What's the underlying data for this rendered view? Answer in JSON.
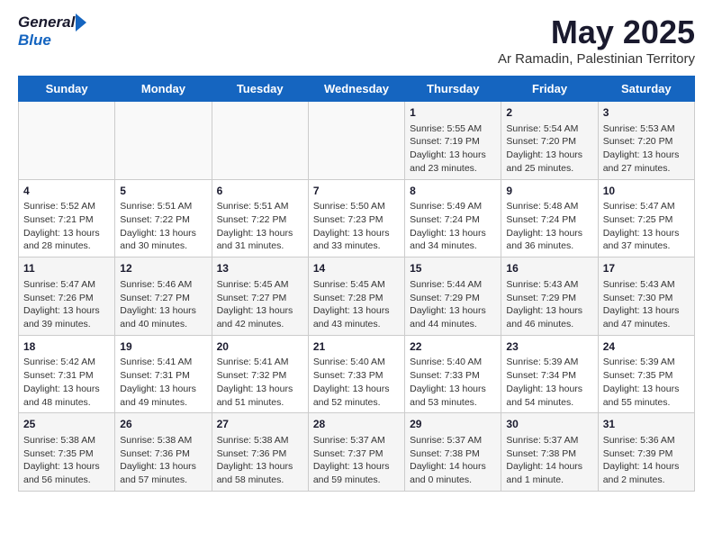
{
  "header": {
    "logo_general": "General",
    "logo_blue": "Blue",
    "title": "May 2025",
    "subtitle": "Ar Ramadin, Palestinian Territory"
  },
  "days_of_week": [
    "Sunday",
    "Monday",
    "Tuesday",
    "Wednesday",
    "Thursday",
    "Friday",
    "Saturday"
  ],
  "weeks": [
    {
      "days": [
        {
          "num": "",
          "sunrise": "",
          "sunset": "",
          "daylight": ""
        },
        {
          "num": "",
          "sunrise": "",
          "sunset": "",
          "daylight": ""
        },
        {
          "num": "",
          "sunrise": "",
          "sunset": "",
          "daylight": ""
        },
        {
          "num": "",
          "sunrise": "",
          "sunset": "",
          "daylight": ""
        },
        {
          "num": "1",
          "sunrise": "Sunrise: 5:55 AM",
          "sunset": "Sunset: 7:19 PM",
          "daylight": "Daylight: 13 hours and 23 minutes."
        },
        {
          "num": "2",
          "sunrise": "Sunrise: 5:54 AM",
          "sunset": "Sunset: 7:20 PM",
          "daylight": "Daylight: 13 hours and 25 minutes."
        },
        {
          "num": "3",
          "sunrise": "Sunrise: 5:53 AM",
          "sunset": "Sunset: 7:20 PM",
          "daylight": "Daylight: 13 hours and 27 minutes."
        }
      ]
    },
    {
      "days": [
        {
          "num": "4",
          "sunrise": "Sunrise: 5:52 AM",
          "sunset": "Sunset: 7:21 PM",
          "daylight": "Daylight: 13 hours and 28 minutes."
        },
        {
          "num": "5",
          "sunrise": "Sunrise: 5:51 AM",
          "sunset": "Sunset: 7:22 PM",
          "daylight": "Daylight: 13 hours and 30 minutes."
        },
        {
          "num": "6",
          "sunrise": "Sunrise: 5:51 AM",
          "sunset": "Sunset: 7:22 PM",
          "daylight": "Daylight: 13 hours and 31 minutes."
        },
        {
          "num": "7",
          "sunrise": "Sunrise: 5:50 AM",
          "sunset": "Sunset: 7:23 PM",
          "daylight": "Daylight: 13 hours and 33 minutes."
        },
        {
          "num": "8",
          "sunrise": "Sunrise: 5:49 AM",
          "sunset": "Sunset: 7:24 PM",
          "daylight": "Daylight: 13 hours and 34 minutes."
        },
        {
          "num": "9",
          "sunrise": "Sunrise: 5:48 AM",
          "sunset": "Sunset: 7:24 PM",
          "daylight": "Daylight: 13 hours and 36 minutes."
        },
        {
          "num": "10",
          "sunrise": "Sunrise: 5:47 AM",
          "sunset": "Sunset: 7:25 PM",
          "daylight": "Daylight: 13 hours and 37 minutes."
        }
      ]
    },
    {
      "days": [
        {
          "num": "11",
          "sunrise": "Sunrise: 5:47 AM",
          "sunset": "Sunset: 7:26 PM",
          "daylight": "Daylight: 13 hours and 39 minutes."
        },
        {
          "num": "12",
          "sunrise": "Sunrise: 5:46 AM",
          "sunset": "Sunset: 7:27 PM",
          "daylight": "Daylight: 13 hours and 40 minutes."
        },
        {
          "num": "13",
          "sunrise": "Sunrise: 5:45 AM",
          "sunset": "Sunset: 7:27 PM",
          "daylight": "Daylight: 13 hours and 42 minutes."
        },
        {
          "num": "14",
          "sunrise": "Sunrise: 5:45 AM",
          "sunset": "Sunset: 7:28 PM",
          "daylight": "Daylight: 13 hours and 43 minutes."
        },
        {
          "num": "15",
          "sunrise": "Sunrise: 5:44 AM",
          "sunset": "Sunset: 7:29 PM",
          "daylight": "Daylight: 13 hours and 44 minutes."
        },
        {
          "num": "16",
          "sunrise": "Sunrise: 5:43 AM",
          "sunset": "Sunset: 7:29 PM",
          "daylight": "Daylight: 13 hours and 46 minutes."
        },
        {
          "num": "17",
          "sunrise": "Sunrise: 5:43 AM",
          "sunset": "Sunset: 7:30 PM",
          "daylight": "Daylight: 13 hours and 47 minutes."
        }
      ]
    },
    {
      "days": [
        {
          "num": "18",
          "sunrise": "Sunrise: 5:42 AM",
          "sunset": "Sunset: 7:31 PM",
          "daylight": "Daylight: 13 hours and 48 minutes."
        },
        {
          "num": "19",
          "sunrise": "Sunrise: 5:41 AM",
          "sunset": "Sunset: 7:31 PM",
          "daylight": "Daylight: 13 hours and 49 minutes."
        },
        {
          "num": "20",
          "sunrise": "Sunrise: 5:41 AM",
          "sunset": "Sunset: 7:32 PM",
          "daylight": "Daylight: 13 hours and 51 minutes."
        },
        {
          "num": "21",
          "sunrise": "Sunrise: 5:40 AM",
          "sunset": "Sunset: 7:33 PM",
          "daylight": "Daylight: 13 hours and 52 minutes."
        },
        {
          "num": "22",
          "sunrise": "Sunrise: 5:40 AM",
          "sunset": "Sunset: 7:33 PM",
          "daylight": "Daylight: 13 hours and 53 minutes."
        },
        {
          "num": "23",
          "sunrise": "Sunrise: 5:39 AM",
          "sunset": "Sunset: 7:34 PM",
          "daylight": "Daylight: 13 hours and 54 minutes."
        },
        {
          "num": "24",
          "sunrise": "Sunrise: 5:39 AM",
          "sunset": "Sunset: 7:35 PM",
          "daylight": "Daylight: 13 hours and 55 minutes."
        }
      ]
    },
    {
      "days": [
        {
          "num": "25",
          "sunrise": "Sunrise: 5:38 AM",
          "sunset": "Sunset: 7:35 PM",
          "daylight": "Daylight: 13 hours and 56 minutes."
        },
        {
          "num": "26",
          "sunrise": "Sunrise: 5:38 AM",
          "sunset": "Sunset: 7:36 PM",
          "daylight": "Daylight: 13 hours and 57 minutes."
        },
        {
          "num": "27",
          "sunrise": "Sunrise: 5:38 AM",
          "sunset": "Sunset: 7:36 PM",
          "daylight": "Daylight: 13 hours and 58 minutes."
        },
        {
          "num": "28",
          "sunrise": "Sunrise: 5:37 AM",
          "sunset": "Sunset: 7:37 PM",
          "daylight": "Daylight: 13 hours and 59 minutes."
        },
        {
          "num": "29",
          "sunrise": "Sunrise: 5:37 AM",
          "sunset": "Sunset: 7:38 PM",
          "daylight": "Daylight: 14 hours and 0 minutes."
        },
        {
          "num": "30",
          "sunrise": "Sunrise: 5:37 AM",
          "sunset": "Sunset: 7:38 PM",
          "daylight": "Daylight: 14 hours and 1 minute."
        },
        {
          "num": "31",
          "sunrise": "Sunrise: 5:36 AM",
          "sunset": "Sunset: 7:39 PM",
          "daylight": "Daylight: 14 hours and 2 minutes."
        }
      ]
    }
  ]
}
